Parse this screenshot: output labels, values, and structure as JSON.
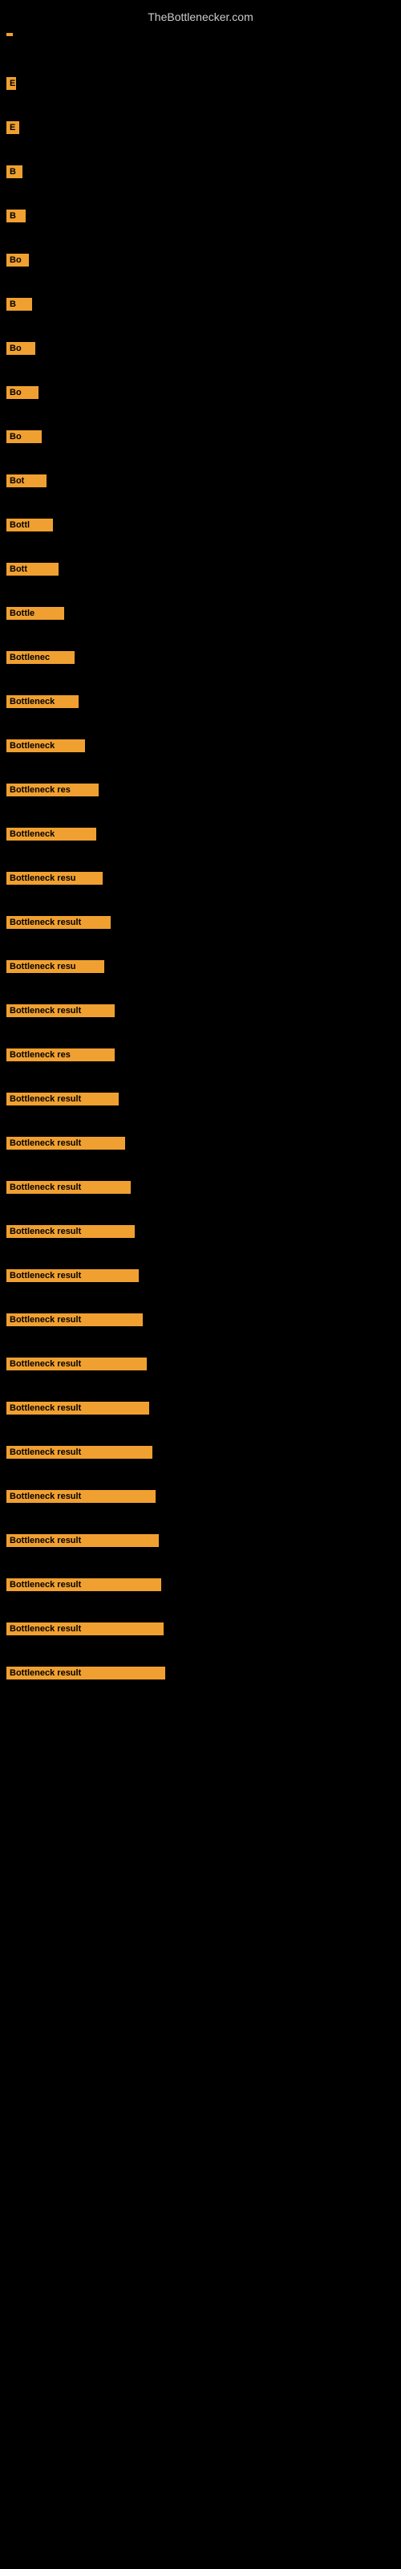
{
  "site": {
    "title": "TheBottlenecker.com"
  },
  "items": [
    {
      "id": 0,
      "label": ""
    },
    {
      "id": 1,
      "label": "E"
    },
    {
      "id": 2,
      "label": "E"
    },
    {
      "id": 3,
      "label": "B"
    },
    {
      "id": 4,
      "label": "B"
    },
    {
      "id": 5,
      "label": "Bo"
    },
    {
      "id": 6,
      "label": "B"
    },
    {
      "id": 7,
      "label": "Bo"
    },
    {
      "id": 8,
      "label": "Bo"
    },
    {
      "id": 9,
      "label": "Bo"
    },
    {
      "id": 10,
      "label": "Bot"
    },
    {
      "id": 11,
      "label": "Bottl"
    },
    {
      "id": 12,
      "label": "Bott"
    },
    {
      "id": 13,
      "label": "Bottle"
    },
    {
      "id": 14,
      "label": "Bottlenec"
    },
    {
      "id": 15,
      "label": "Bottleneck"
    },
    {
      "id": 16,
      "label": "Bottleneck"
    },
    {
      "id": 17,
      "label": "Bottleneck res"
    },
    {
      "id": 18,
      "label": "Bottleneck"
    },
    {
      "id": 19,
      "label": "Bottleneck resu"
    },
    {
      "id": 20,
      "label": "Bottleneck result"
    },
    {
      "id": 21,
      "label": "Bottleneck resu"
    },
    {
      "id": 22,
      "label": "Bottleneck result"
    },
    {
      "id": 23,
      "label": "Bottleneck res"
    },
    {
      "id": 24,
      "label": "Bottleneck result"
    },
    {
      "id": 25,
      "label": "Bottleneck result"
    },
    {
      "id": 26,
      "label": "Bottleneck result"
    },
    {
      "id": 27,
      "label": "Bottleneck result"
    },
    {
      "id": 28,
      "label": "Bottleneck result"
    },
    {
      "id": 29,
      "label": "Bottleneck result"
    },
    {
      "id": 30,
      "label": "Bottleneck result"
    },
    {
      "id": 31,
      "label": "Bottleneck result"
    },
    {
      "id": 32,
      "label": "Bottleneck result"
    },
    {
      "id": 33,
      "label": "Bottleneck result"
    },
    {
      "id": 34,
      "label": "Bottleneck result"
    },
    {
      "id": 35,
      "label": "Bottleneck result"
    },
    {
      "id": 36,
      "label": "Bottleneck result"
    },
    {
      "id": 37,
      "label": "Bottleneck result"
    }
  ]
}
